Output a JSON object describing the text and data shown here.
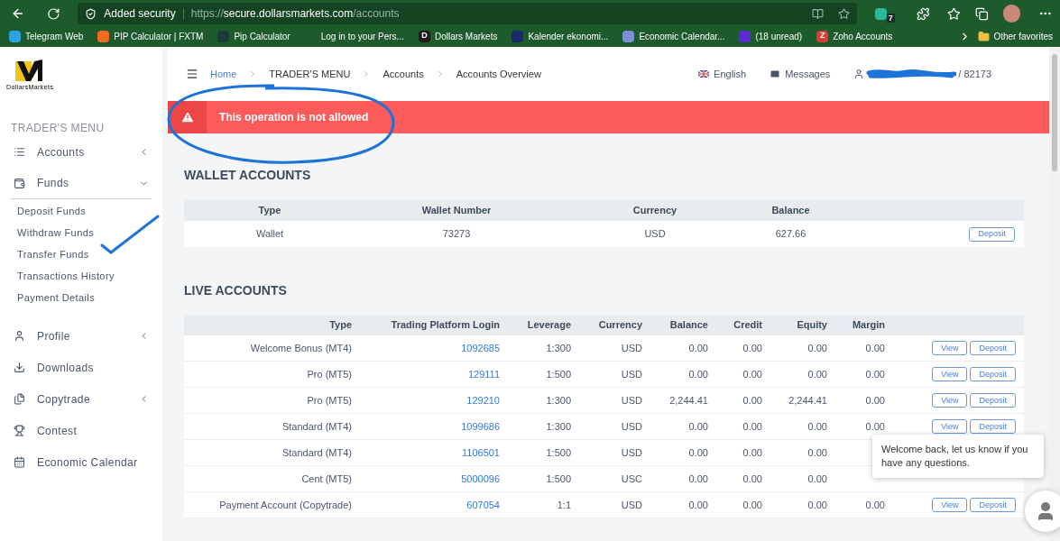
{
  "browser": {
    "security": "Added security",
    "url_scheme": "https://",
    "url_host": "secure.dollarsmarkets.com",
    "url_path": "/accounts",
    "extension_badge": "7",
    "bookmarks": [
      {
        "label": "Telegram Web",
        "color": "#2aa3df"
      },
      {
        "label": "PIP Calculator | FXTM",
        "color": "#f26b21"
      },
      {
        "label": "Pip Calculator",
        "color": "#1a3b3a"
      },
      {
        "label": "Log in to your Pers..."
      },
      {
        "label": "Dollars Markets",
        "color": "#1d1d1d",
        "glyph": "D"
      },
      {
        "label": "Kalender ekonomi...",
        "color": "#1b2a6b"
      },
      {
        "label": "Economic Calendar...",
        "color": "#7b8fd6"
      },
      {
        "label": "(18 unread)",
        "color": "#5b2bd6"
      },
      {
        "label": "Zoho Accounts",
        "color": "#e13b36",
        "glyph": "Z"
      }
    ],
    "other_favorites": "Other favorites"
  },
  "logo": {
    "caption": "DollarsMarkets"
  },
  "sidebar": {
    "heading": "TRADER'S MENU",
    "items": [
      {
        "label": "Accounts",
        "expanded": false
      },
      {
        "label": "Funds",
        "expanded": true,
        "children": [
          {
            "label": "Deposit Funds"
          },
          {
            "label": "Withdraw Funds"
          },
          {
            "label": "Transfer Funds"
          },
          {
            "label": "Transactions History"
          },
          {
            "label": "Payment Details"
          }
        ]
      },
      {
        "label": "Profile",
        "expanded": false
      },
      {
        "label": "Downloads"
      },
      {
        "label": "Copytrade",
        "expanded": false
      },
      {
        "label": "Contest"
      },
      {
        "label": "Economic Calendar"
      }
    ]
  },
  "header": {
    "breadcrumbs": [
      {
        "label": "Home",
        "link": true
      },
      {
        "label": "TRADER'S MENU",
        "link": false
      },
      {
        "label": "Accounts",
        "link": false
      },
      {
        "label": "Accounts Overview",
        "link": false
      }
    ],
    "language": "English",
    "messages": "Messages",
    "account_suffix": "/ 82173"
  },
  "alert": {
    "message": "This operation is not allowed"
  },
  "wallet_accounts": {
    "title": "WALLET ACCOUNTS",
    "columns": [
      "Type",
      "Wallet Number",
      "Currency",
      "Balance"
    ],
    "rows": [
      {
        "cells": [
          "Wallet",
          "73273",
          "USD",
          "627.66"
        ],
        "action": "Deposit"
      }
    ]
  },
  "live_accounts": {
    "title": "LIVE ACCOUNTS",
    "columns": [
      "Type",
      "Trading Platform Login",
      "Leverage",
      "Currency",
      "Balance",
      "Credit",
      "Equity",
      "Margin"
    ],
    "rows": [
      {
        "cells": [
          "Welcome Bonus (MT4)",
          "1092685",
          "1:300",
          "USD",
          "0.00",
          "0.00",
          "0.00",
          "0.00"
        ],
        "actions": [
          "View",
          "Deposit"
        ]
      },
      {
        "cells": [
          "Pro (MT5)",
          "129111",
          "1:500",
          "USD",
          "0.00",
          "0.00",
          "0.00",
          "0.00"
        ],
        "actions": [
          "View",
          "Deposit"
        ]
      },
      {
        "cells": [
          "Pro (MT5)",
          "129210",
          "1:300",
          "USD",
          "2,244.41",
          "0.00",
          "2,244.41",
          "0.00"
        ],
        "actions": [
          "View",
          "Deposit"
        ]
      },
      {
        "cells": [
          "Standard (MT4)",
          "1099686",
          "1:300",
          "USD",
          "0.00",
          "0.00",
          "0.00",
          "0.00"
        ],
        "actions": [
          "View",
          "Deposit"
        ]
      },
      {
        "cells": [
          "Standard (MT4)",
          "1106501",
          "1:500",
          "USD",
          "0.00",
          "0.00",
          "0.00"
        ]
      },
      {
        "cells": [
          "Cent (MT5)",
          "5000096",
          "1:500",
          "USC",
          "0.00",
          "0.00",
          "0.00"
        ]
      },
      {
        "cells": [
          "Payment Account (Copytrade)",
          "607054",
          "1:1",
          "USD",
          "0.00",
          "0.00",
          "0.00",
          "0.00"
        ],
        "actions": [
          "View",
          "Deposit"
        ]
      }
    ]
  },
  "chat": {
    "message": "Welcome back, let us know if you have any questions."
  }
}
